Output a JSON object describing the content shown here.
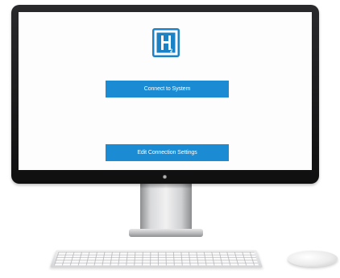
{
  "screen": {
    "logo_icon": "h2-logo-icon",
    "accent_color": "#1b8bd3",
    "buttons": {
      "connect_label": "Connect to System",
      "edit_label": "Edit Connection Settings"
    }
  }
}
